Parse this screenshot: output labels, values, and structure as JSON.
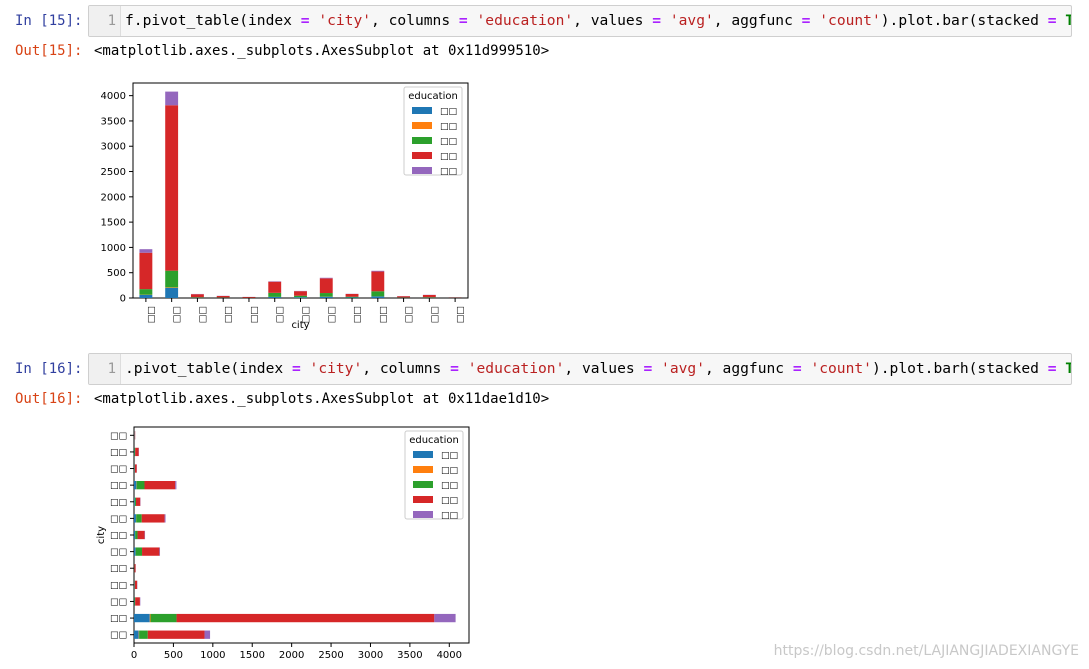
{
  "cells": [
    {
      "in_prompt": "In [15]:",
      "line_no": "1",
      "code_parts": [
        "f.pivot_table(index ",
        "=",
        " ",
        "'city'",
        ", columns ",
        "=",
        " ",
        "'education'",
        ", values ",
        "=",
        " ",
        "'avg'",
        ", aggfunc ",
        "=",
        " ",
        "'count'",
        ").plot.bar(stacked ",
        "=",
        " ",
        "True",
        ")"
      ],
      "out_prompt": "Out[15]:",
      "out_text": "<matplotlib.axes._subplots.AxesSubplot at 0x11d999510>"
    },
    {
      "in_prompt": "In [16]:",
      "line_no": "1",
      "code_parts": [
        ".pivot_table(index ",
        "=",
        " ",
        "'city'",
        ", columns ",
        "=",
        " ",
        "'education'",
        ", values ",
        "=",
        " ",
        "'avg'",
        ", aggfunc ",
        "=",
        " ",
        "'count'",
        ").plot.barh(stacked ",
        "=",
        " ",
        "True",
        ")"
      ],
      "out_prompt": "Out[16]:",
      "out_text": "<matplotlib.axes._subplots.AxesSubplot at 0x11dae1d10>"
    }
  ],
  "colors": {
    "s1": "#1f77b4",
    "s2": "#ff7f0e",
    "s3": "#2ca02c",
    "s4": "#d62728",
    "s5": "#9467bd"
  },
  "chart_data": [
    {
      "type": "bar",
      "stacked": true,
      "xlabel": "city",
      "ylabel": "",
      "ylim": [
        0,
        4250
      ],
      "yticks": [
        0,
        500,
        1000,
        1500,
        2000,
        2500,
        3000,
        3500,
        4000
      ],
      "categories": [
        "□□",
        "□□",
        "□□",
        "□□",
        "□□",
        "□□",
        "□□",
        "□□",
        "□□",
        "□□",
        "□□",
        "□□",
        "□□"
      ],
      "legend_title": "education",
      "legend_position": "top-right",
      "series": [
        {
          "name": "□□",
          "values": [
            60,
            200,
            5,
            5,
            2,
            20,
            15,
            25,
            10,
            30,
            5,
            5,
            5
          ]
        },
        {
          "name": "□□",
          "values": [
            5,
            10,
            0,
            0,
            0,
            2,
            0,
            3,
            0,
            3,
            0,
            0,
            0
          ]
        },
        {
          "name": "□□",
          "values": [
            110,
            330,
            10,
            5,
            3,
            80,
            30,
            70,
            15,
            100,
            5,
            10,
            3
          ]
        },
        {
          "name": "□□",
          "values": [
            720,
            3270,
            60,
            30,
            15,
            220,
            90,
            290,
            55,
            390,
            25,
            45,
            7
          ]
        },
        {
          "name": "□□",
          "values": [
            70,
            270,
            5,
            3,
            2,
            8,
            5,
            12,
            3,
            15,
            2,
            3,
            1
          ]
        }
      ]
    },
    {
      "type": "barh",
      "stacked": true,
      "xlabel": "",
      "ylabel": "city",
      "xlim": [
        0,
        4250
      ],
      "xticks": [
        0,
        500,
        1000,
        1500,
        2000,
        2500,
        3000,
        3500,
        4000
      ],
      "categories": [
        "□□",
        "□□",
        "□□",
        "□□",
        "□□",
        "□□",
        "□□",
        "□□",
        "□□",
        "□□",
        "□□",
        "□□",
        "□□"
      ],
      "legend_title": "education",
      "legend_position": "top-right",
      "series": [
        {
          "name": "□□",
          "values": [
            60,
            200,
            5,
            5,
            2,
            20,
            15,
            25,
            10,
            30,
            5,
            5,
            5
          ]
        },
        {
          "name": "□□",
          "values": [
            5,
            10,
            0,
            0,
            0,
            2,
            0,
            3,
            0,
            3,
            0,
            0,
            0
          ]
        },
        {
          "name": "□□",
          "values": [
            110,
            330,
            10,
            5,
            3,
            80,
            30,
            70,
            15,
            100,
            5,
            10,
            3
          ]
        },
        {
          "name": "□□",
          "values": [
            720,
            3270,
            60,
            30,
            15,
            220,
            90,
            290,
            55,
            390,
            25,
            45,
            7
          ]
        },
        {
          "name": "□□",
          "values": [
            70,
            270,
            5,
            3,
            2,
            8,
            5,
            12,
            3,
            15,
            2,
            3,
            1
          ]
        }
      ]
    }
  ],
  "watermark": "https://blog.csdn.net/LAJIANGJIADEXIANGYE"
}
